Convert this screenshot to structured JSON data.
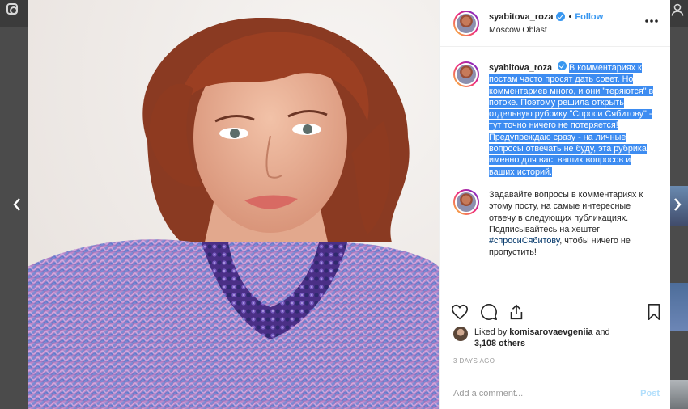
{
  "post": {
    "username": "syabitova_roza",
    "follow_label": "Follow",
    "separator": "•",
    "location": "Moscow Oblast",
    "caption_parts": [
      "В комментариях к постам часто просят дать совет. Но комментариев много, и они \"теряются\" в потоке. Поэтому решила открыть отдельную рубрику \"Спроси Сябитову\" - тут точно ничего не потеряется! Предупреждаю сразу - на личные вопросы отвечать не буду, эта рубрика именно для вас, ваших вопросов и ваших историй."
    ],
    "second_comment": {
      "text_before": "Задавайте вопросы в комментариях к этому посту, на самые интересные отвечу в следующих публикациях. Подписывайтесь на хештег ",
      "hashtag": "#спросиСябитову",
      "text_after": ", чтобы ничего не пропустить!"
    },
    "liked_by_prefix": "Liked by ",
    "liked_by_user": "komisarovaevgeniia",
    "liked_by_and": " and",
    "liked_by_count": "3,108 others",
    "timestamp": "3 DAYS AGO",
    "add_comment_placeholder": "Add a comment...",
    "post_label": "Post"
  },
  "icons": {
    "verified": "verified-badge-icon",
    "more": "more-options-icon",
    "like": "heart-icon",
    "comment": "comment-icon",
    "share": "share-icon",
    "save": "bookmark-icon",
    "prev": "chevron-left-icon",
    "next": "chevron-right-icon"
  },
  "colors": {
    "link_blue": "#3897f0",
    "highlight": "#3d8cf1",
    "hashtag": "#003569",
    "muted": "#999999"
  }
}
